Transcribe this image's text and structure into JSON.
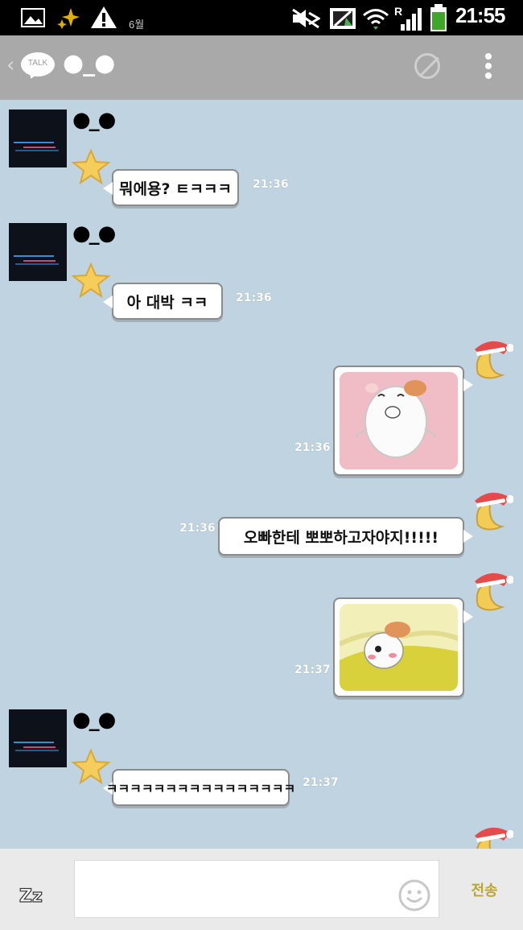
{
  "status_bar": {
    "date_text": "6월",
    "r_text": "R",
    "time": "21:55",
    "icons": [
      "gallery-icon",
      "sparkle-icon",
      "warning-icon",
      "mute-icon",
      "signal-blocked-icon",
      "wifi-icon",
      "cell-signal-icon",
      "battery-icon"
    ]
  },
  "header": {
    "back_label": "‹",
    "talk_label": "TALK",
    "chat_title": "●_●",
    "icons": [
      "mute-toggle-icon",
      "more-menu-icon"
    ]
  },
  "messages": [
    {
      "side": "left",
      "nick": "●_●",
      "text": "뭐에용? ㅌㅋㅋㅋ",
      "time": "21:36"
    },
    {
      "side": "left",
      "nick": "●_●",
      "text": "아 대박 ㅋㅋ",
      "time": "21:36"
    },
    {
      "side": "right",
      "type": "image",
      "alt": "hamster sticker",
      "time": "21:36"
    },
    {
      "side": "right",
      "text": "오빠한테 뽀뽀하고자야지!!!!!",
      "time": "21:36"
    },
    {
      "side": "right",
      "type": "image",
      "alt": "sleeping hamster sticker",
      "time": "21:37"
    },
    {
      "side": "left",
      "nick": "●_●",
      "text": "ㅋㅋㅋㅋㅋㅋㅋㅋㅋㅋㅋㅋㅋㅋㅋㅋ",
      "time": "21:37"
    }
  ],
  "input": {
    "value": "",
    "send_label": "전송",
    "zz_label": "Zz"
  },
  "colors": {
    "chat_bg": "#bfd3e0",
    "header_bg": "#a9a9a9",
    "send_text": "#b9a637"
  }
}
